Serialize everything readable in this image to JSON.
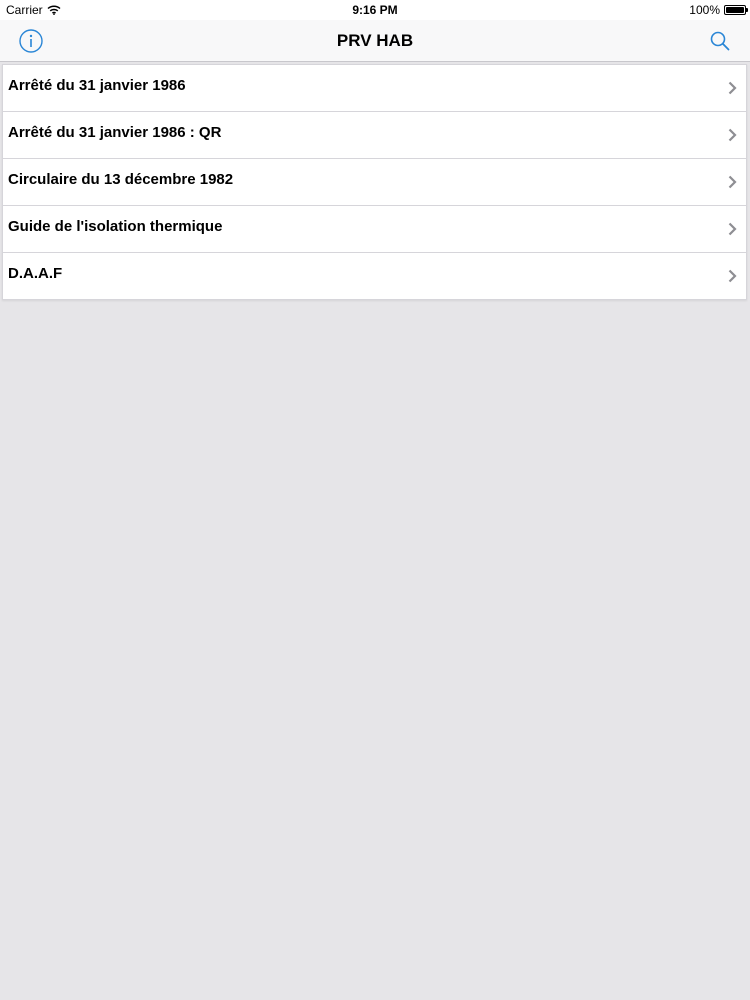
{
  "status_bar": {
    "carrier": "Carrier",
    "time": "9:16 PM",
    "battery": "100%",
    "icons": [
      "wifi-icon",
      "battery-icon"
    ]
  },
  "nav": {
    "title": "PRV HAB",
    "left_icon": "info-icon",
    "right_icon": "search-icon",
    "accent_color": "#2a86d6"
  },
  "list": {
    "items": [
      {
        "label": "Arrêté du 31 janvier 1986",
        "icon": "chevron-right-icon"
      },
      {
        "label": "Arrêté du 31 janvier 1986 : QR",
        "icon": "chevron-right-icon"
      },
      {
        "label": "Circulaire du 13 décembre 1982",
        "icon": "chevron-right-icon"
      },
      {
        "label": "Guide de l'isolation thermique",
        "icon": "chevron-right-icon"
      },
      {
        "label": "D.A.A.F",
        "icon": "chevron-right-icon"
      }
    ]
  },
  "colors": {
    "background": "#e6e5e8",
    "list_background": "#ffffff",
    "separator": "#d6d5da",
    "chevron": "#8e8e93"
  }
}
